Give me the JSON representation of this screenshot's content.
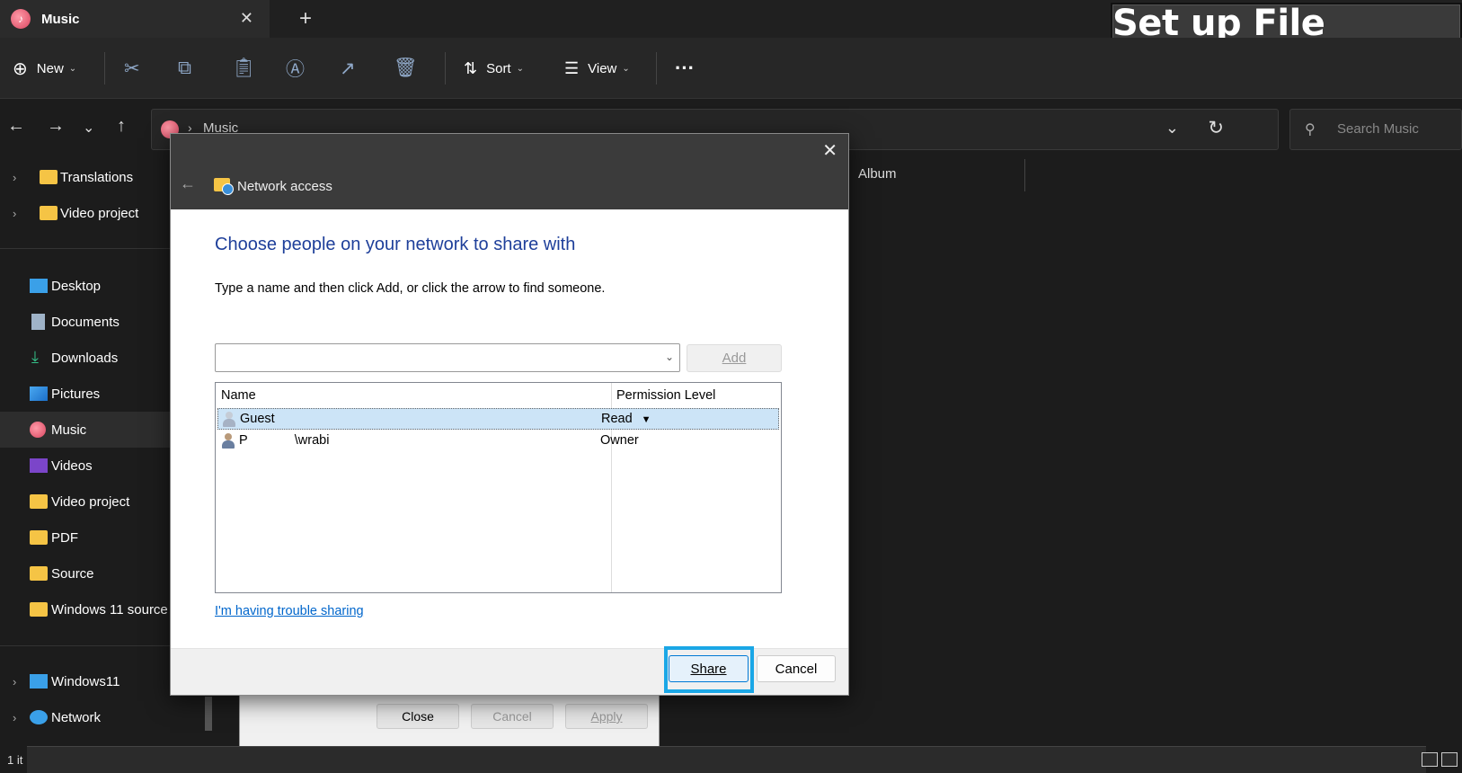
{
  "window": {
    "tab_title": "Music",
    "tab_close_icon": "close-icon",
    "new_tab_icon": "plus-icon"
  },
  "toolbar": {
    "new_label": "New",
    "sort_label": "Sort",
    "view_label": "View",
    "more_icon": "ellipsis-icon"
  },
  "banner": {
    "text": "Set up File Sharing"
  },
  "address": {
    "path": "Music",
    "search_placeholder": "Search Music"
  },
  "sidebar": {
    "items": [
      {
        "label": "Translations"
      },
      {
        "label": "Video project"
      },
      {
        "label": "Desktop"
      },
      {
        "label": "Documents"
      },
      {
        "label": "Downloads"
      },
      {
        "label": "Pictures"
      },
      {
        "label": "Music"
      },
      {
        "label": "Videos"
      },
      {
        "label": "Video project"
      },
      {
        "label": "PDF"
      },
      {
        "label": "Source"
      },
      {
        "label": "Windows 11 source"
      },
      {
        "label": "Windows11"
      },
      {
        "label": "Network"
      }
    ]
  },
  "content": {
    "column_album": "Album"
  },
  "background_dialog": {
    "close_label": "Close",
    "cancel_label": "Cancel",
    "apply_label": "Apply"
  },
  "statusbar": {
    "text": "1 it"
  },
  "dialog": {
    "title": "Network access",
    "heading": "Choose people on your network to share with",
    "instruction": "Type a name and then click Add, or click the arrow to find someone.",
    "add_label": "Add",
    "columns": {
      "name": "Name",
      "permission": "Permission Level"
    },
    "rows": [
      {
        "name": "Guest",
        "permission": "Read"
      },
      {
        "name": "P             \\wrabi",
        "permission": "Owner"
      }
    ],
    "trouble_link": "I'm having trouble sharing",
    "share_label": "Share",
    "cancel_label": "Cancel"
  },
  "colors": {
    "heading": "#1e3f9a",
    "highlight": "#1aa7e6",
    "link": "#0066cc"
  }
}
